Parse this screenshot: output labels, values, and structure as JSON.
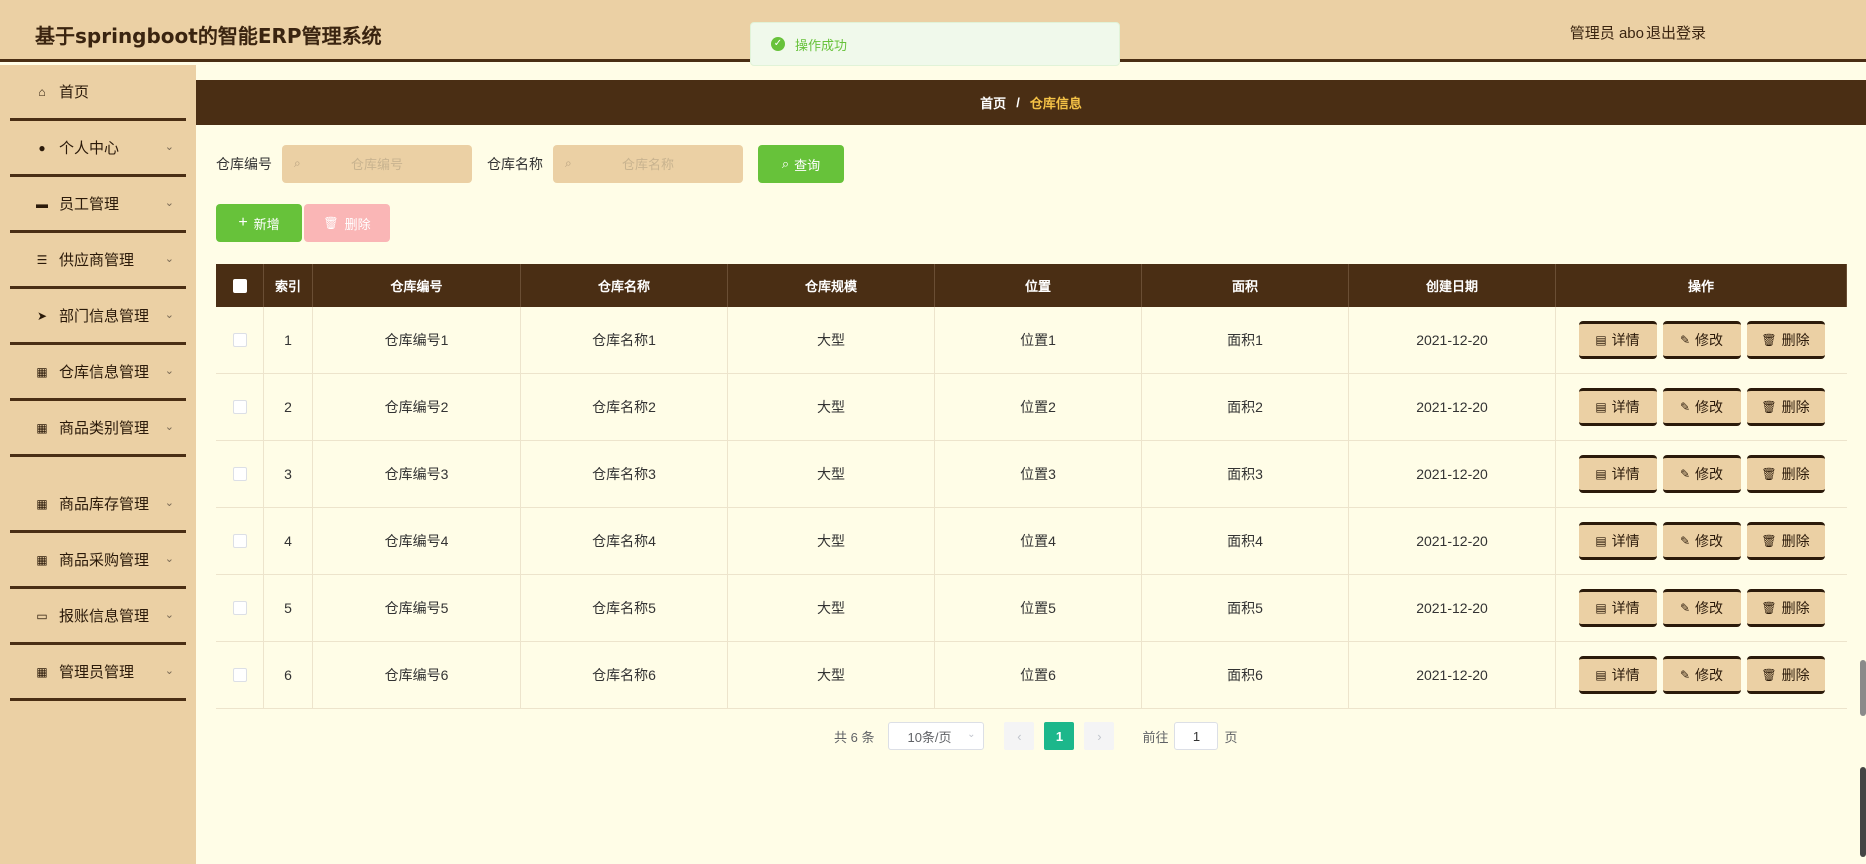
{
  "header": {
    "title": "基于springboot的智能ERP管理系统",
    "user": "管理员 abo",
    "logout": "退出登录"
  },
  "toast": {
    "message": "操作成功",
    "type": "success"
  },
  "sidebar": {
    "items": [
      {
        "label": "首页",
        "icon": "home-icon",
        "glyph": "⌂"
      },
      {
        "label": "个人中心",
        "icon": "user-icon",
        "glyph": "●"
      },
      {
        "label": "员工管理",
        "icon": "chat-icon",
        "glyph": "▬"
      },
      {
        "label": "供应商管理",
        "icon": "list-icon",
        "glyph": "☰"
      },
      {
        "label": "部门信息管理",
        "icon": "send-icon",
        "glyph": "➤"
      },
      {
        "label": "仓库信息管理",
        "icon": "grid-icon",
        "glyph": "▦"
      },
      {
        "label": "商品类别管理",
        "icon": "grid-icon",
        "glyph": "▦"
      },
      {
        "label": "商品库存管理",
        "icon": "grid-icon",
        "glyph": "▦"
      },
      {
        "label": "商品采购管理",
        "icon": "grid-icon",
        "glyph": "▦"
      },
      {
        "label": "报账信息管理",
        "icon": "monitor-icon",
        "glyph": "▭"
      },
      {
        "label": "管理员管理",
        "icon": "grid-icon",
        "glyph": "▦"
      }
    ]
  },
  "breadcrumb": {
    "home": "首页",
    "sep": "/",
    "current": "仓库信息"
  },
  "search": {
    "code_label": "仓库编号",
    "code_placeholder": "仓库编号",
    "name_label": "仓库名称",
    "name_placeholder": "仓库名称",
    "query_button": "查询"
  },
  "actions": {
    "add": "新增",
    "delete": "删除"
  },
  "table": {
    "headers": [
      "索引",
      "仓库编号",
      "仓库名称",
      "仓库规模",
      "位置",
      "面积",
      "创建日期",
      "操作"
    ],
    "rows": [
      {
        "idx": "1",
        "code": "仓库编号1",
        "name": "仓库名称1",
        "scale": "大型",
        "loc": "位置1",
        "area": "面积1",
        "date": "2021-12-20"
      },
      {
        "idx": "2",
        "code": "仓库编号2",
        "name": "仓库名称2",
        "scale": "大型",
        "loc": "位置2",
        "area": "面积2",
        "date": "2021-12-20"
      },
      {
        "idx": "3",
        "code": "仓库编号3",
        "name": "仓库名称3",
        "scale": "大型",
        "loc": "位置3",
        "area": "面积3",
        "date": "2021-12-20"
      },
      {
        "idx": "4",
        "code": "仓库编号4",
        "name": "仓库名称4",
        "scale": "大型",
        "loc": "位置4",
        "area": "面积4",
        "date": "2021-12-20"
      },
      {
        "idx": "5",
        "code": "仓库编号5",
        "name": "仓库名称5",
        "scale": "大型",
        "loc": "位置5",
        "area": "面积5",
        "date": "2021-12-20"
      },
      {
        "idx": "6",
        "code": "仓库编号6",
        "name": "仓库名称6",
        "scale": "大型",
        "loc": "位置6",
        "area": "面积6",
        "date": "2021-12-20"
      }
    ],
    "ops": {
      "detail": "详情",
      "edit": "修改",
      "delete": "删除"
    }
  },
  "pagination": {
    "total": "共 6 条",
    "page_size": "10条/页",
    "current_page": "1",
    "goto_prefix": "前往",
    "goto_value": "1",
    "goto_suffix": "页"
  },
  "colors": {
    "header_bg": "#ebd0a4",
    "dark_brown": "#4a2e14",
    "content_bg": "#fffde7",
    "success_green": "#67c23a",
    "page_active": "#1cb78b",
    "breadcrumb_current": "#f5c246"
  }
}
